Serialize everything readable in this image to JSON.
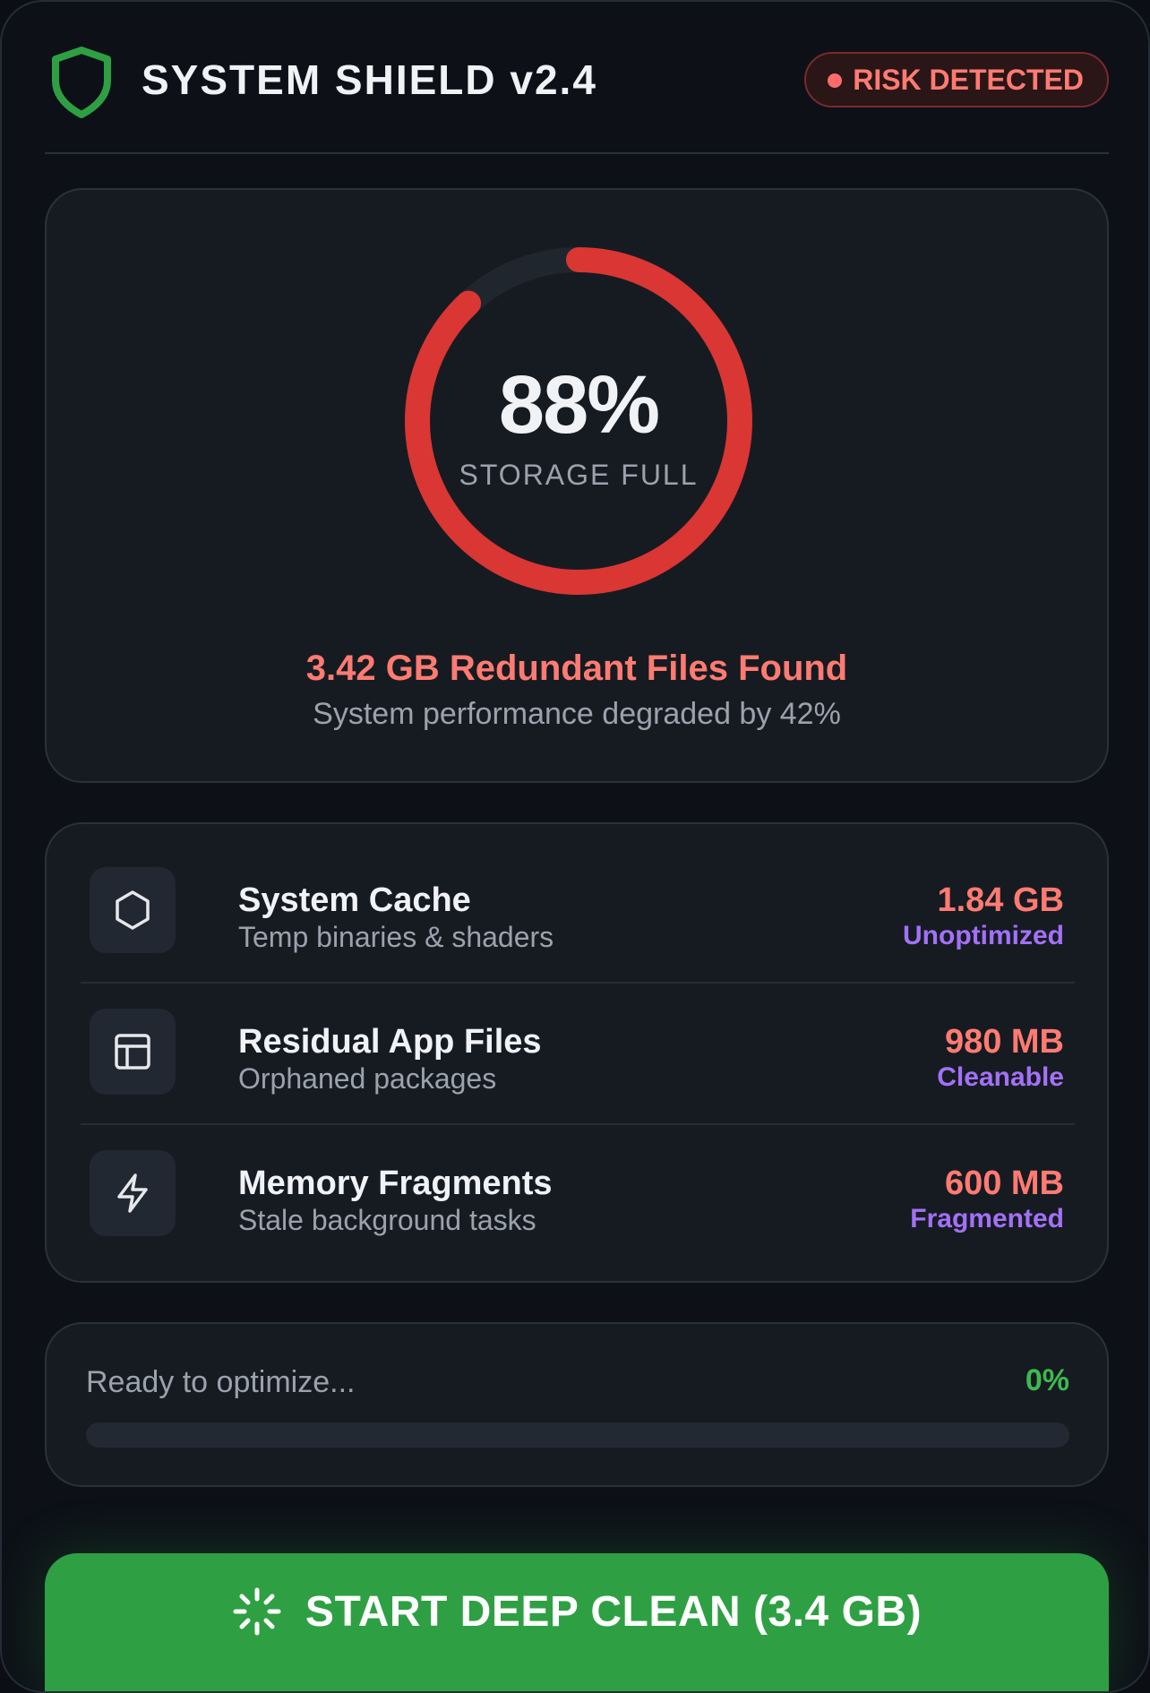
{
  "header": {
    "title": "SYSTEM SHIELD v2.4",
    "logo_icon": "shield-icon",
    "badge": "RISK DETECTED"
  },
  "storage": {
    "percent_label": "88%",
    "percent_value": 88,
    "label": "STORAGE FULL",
    "found": "3.42 GB Redundant Files Found",
    "degraded": "System performance degraded by 42%"
  },
  "items": [
    {
      "icon": "hexagon-icon",
      "title": "System Cache",
      "subtitle": "Temp binaries & shaders",
      "size": "1.84 GB",
      "status": "Unoptimized"
    },
    {
      "icon": "layout-icon",
      "title": "Residual App Files",
      "subtitle": "Orphaned packages",
      "size": "980 MB",
      "status": "Cleanable"
    },
    {
      "icon": "lightning-icon",
      "title": "Memory Fragments",
      "subtitle": "Stale background tasks",
      "size": "600 MB",
      "status": "Fragmented"
    }
  ],
  "progress": {
    "text": "Ready to optimize...",
    "percent_label": "0%",
    "percent_value": 0
  },
  "action": {
    "label": "START DEEP CLEAN (3.4 GB)",
    "icon": "loader-icon"
  },
  "colors": {
    "accent_green": "#2ea043",
    "danger": "#ff7b72",
    "gauge_red": "#da3633",
    "status_purple": "#a371f7",
    "background": "#0d1117",
    "card": "#161b22"
  }
}
